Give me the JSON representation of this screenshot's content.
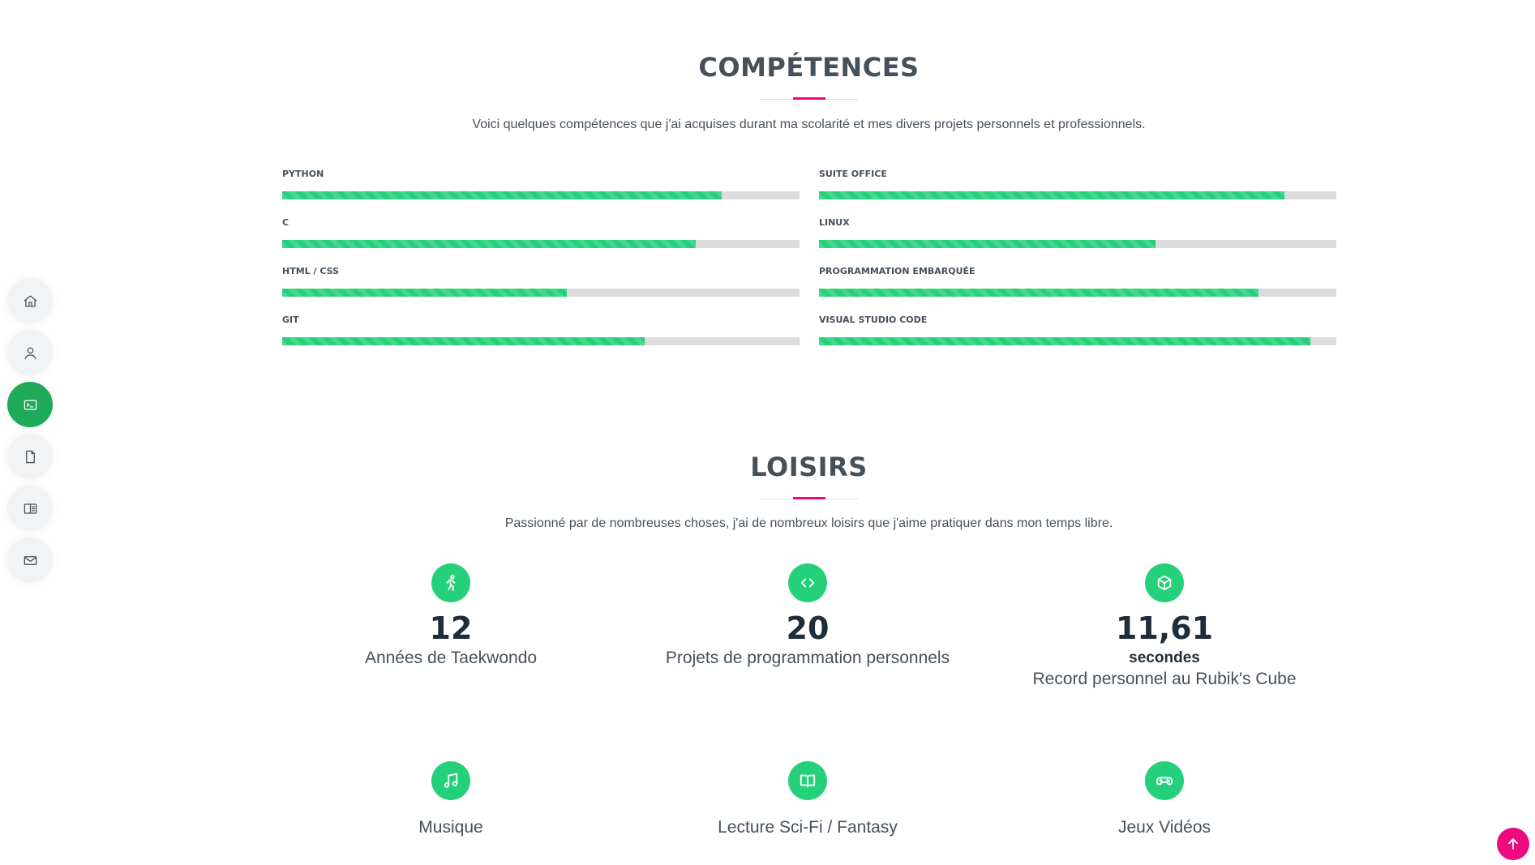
{
  "nav": {
    "items": [
      {
        "name": "home",
        "icon": "house-icon",
        "active": false
      },
      {
        "name": "about",
        "icon": "person-icon",
        "active": false
      },
      {
        "name": "skills",
        "icon": "terminal-icon",
        "active": true
      },
      {
        "name": "resume",
        "icon": "file-icon",
        "active": false
      },
      {
        "name": "portfolio",
        "icon": "book-icon",
        "active": false
      },
      {
        "name": "contact",
        "icon": "envelope-icon",
        "active": false
      }
    ]
  },
  "skills": {
    "title": "COMPÉTENCES",
    "subtitle": "Voici quelques compétences que j'ai acquises durant ma scolarité et mes divers projets personnels et professionnels.",
    "left": [
      {
        "label": "PYTHON",
        "level": 0.85
      },
      {
        "label": "C",
        "level": 0.8
      },
      {
        "label": "HTML / CSS",
        "level": 0.55
      },
      {
        "label": "GIT",
        "level": 0.7
      }
    ],
    "right": [
      {
        "label": "SUITE OFFICE",
        "level": 0.9
      },
      {
        "label": "LINUX",
        "level": 0.65
      },
      {
        "label": "PROGRAMMATION EMBARQUÉE",
        "level": 0.85
      },
      {
        "label": "VISUAL STUDIO CODE",
        "level": 0.95
      }
    ]
  },
  "hobbies": {
    "title": "LOISIRS",
    "subtitle": "Passionné par de nombreuses choses, j'ai de nombreux loisirs que j'aime pratiquer dans mon temps libre.",
    "stats": [
      {
        "icon": "running-person-icon",
        "number": "12",
        "unit": "",
        "label": "Années de Taekwondo"
      },
      {
        "icon": "code-icon",
        "number": "20",
        "unit": "",
        "label": "Projets de programmation personnels"
      },
      {
        "icon": "box-icon",
        "number": "11,61",
        "unit": "secondes",
        "label": "Record personnel au Rubik's Cube"
      }
    ],
    "items": [
      {
        "icon": "music-note-icon",
        "label": "Musique"
      },
      {
        "icon": "open-book-icon",
        "label": "Lecture Sci-Fi / Fantasy"
      },
      {
        "icon": "gamepad-icon",
        "label": "Jeux Vidéos"
      }
    ]
  },
  "colors": {
    "accent_green": "#25d07a",
    "active_nav_green": "#1faa59",
    "accent_pink": "#ec0a7e",
    "text": "#45505b"
  }
}
